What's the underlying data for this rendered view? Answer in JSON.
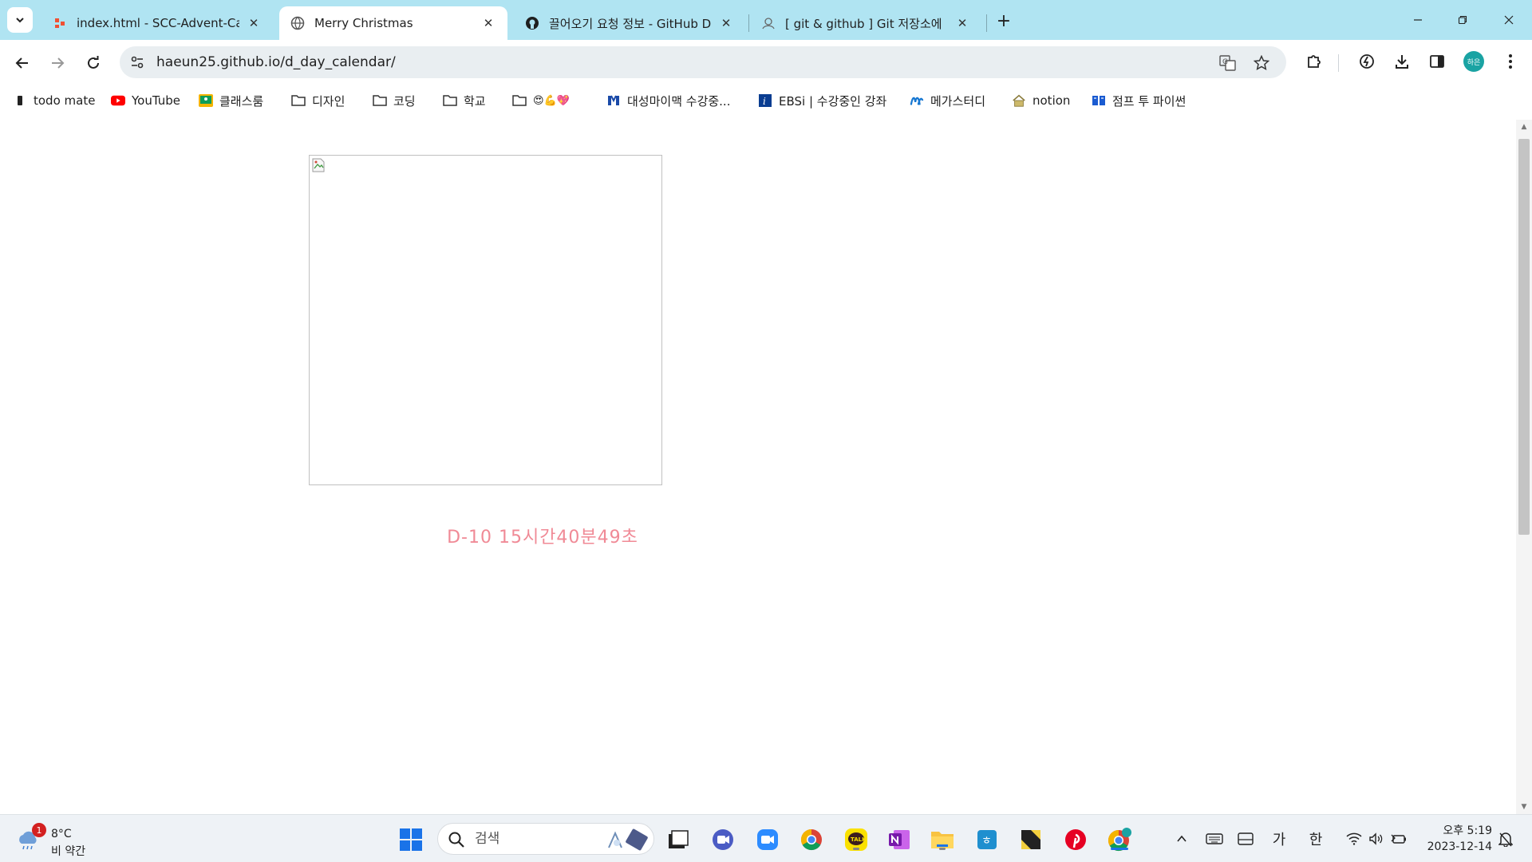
{
  "browser": {
    "tabs": [
      {
        "title": "index.html - SCC-Advent-Calen",
        "icon": "git-branch-icon",
        "active": false
      },
      {
        "title": "Merry Christmas",
        "icon": "globe-icon",
        "active": true
      },
      {
        "title": "끌어오기 요청 정보 - GitHub D",
        "icon": "github-icon",
        "active": false
      },
      {
        "title": "[ git & github ] Git 저장소에 ㅁ",
        "icon": "blog-icon",
        "active": false
      }
    ],
    "url": "haeun25.github.io/d_day_calendar/",
    "profile_label": "하은",
    "bookmarks": [
      {
        "label": "todo mate",
        "icon": "todo-mate-icon"
      },
      {
        "label": "YouTube",
        "icon": "youtube-icon"
      },
      {
        "label": "클래스룸",
        "icon": "classroom-icon"
      },
      {
        "label": "디자인",
        "icon": "folder-icon"
      },
      {
        "label": "코딩",
        "icon": "folder-icon"
      },
      {
        "label": "학교",
        "icon": "folder-icon"
      },
      {
        "label": "😍💪💖",
        "icon": "folder-icon"
      },
      {
        "label": "대성마이맥 수강중...",
        "icon": "mimac-icon"
      },
      {
        "label": "EBSi | 수강중인 강좌",
        "icon": "ebsi-icon"
      },
      {
        "label": "메가스터디",
        "icon": "megastudy-icon"
      },
      {
        "label": "notion",
        "icon": "notion-icon"
      },
      {
        "label": "점프 투 파이썬",
        "icon": "wikidocs-icon"
      }
    ]
  },
  "page": {
    "countdown": "D-10 15시간40분49초",
    "countdown_color": "#f08a96"
  },
  "taskbar": {
    "weather_temp": "8°C",
    "weather_condition": "비 약간",
    "weather_badge": "1",
    "search_placeholder": "검색",
    "ime_mode": "가",
    "ime_lang": "한",
    "time": "오후 5:19",
    "date": "2023-12-14"
  },
  "colors": {
    "tabstrip": "#b0e4f2",
    "omnibox": "#e9eef1",
    "taskbar": "#eef2f6"
  }
}
